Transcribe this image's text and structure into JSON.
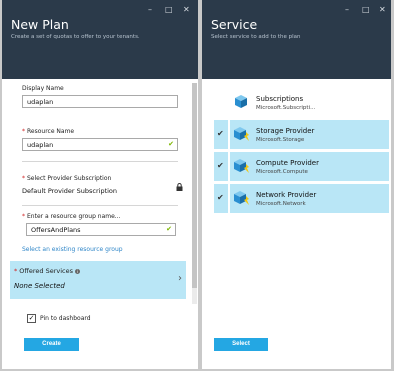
{
  "left_blade": {
    "title": "New Plan",
    "subtitle": "Create a set of quotas to offer to your tenants.",
    "display_name_label": "Display Name",
    "display_name_value": "udaplan",
    "resource_name_label": "Resource Name",
    "resource_name_value": "udaplan",
    "subscription_label": "Select Provider Subscription",
    "subscription_value": "Default Provider Subscription",
    "resource_group_label": "Enter a resource group name...",
    "resource_group_value": "OffersAndPlans",
    "existing_group_link": "Select an existing resource group",
    "offered_services_label": "Offered Services",
    "offered_services_value": "None Selected",
    "pin_label": "Pin to dashboard",
    "pin_checked": true,
    "create_button": "Create",
    "header_buttons": [
      "–",
      "□",
      "✕"
    ],
    "required_mark": "*"
  },
  "right_blade": {
    "title": "Service",
    "subtitle": "Select service to add to the plan",
    "header_buttons": [
      "–",
      "□",
      "✕"
    ],
    "select_button": "Select",
    "services": [
      {
        "name": "Subscriptions",
        "sub": "Microsoft.Subscripti...",
        "selected": false
      },
      {
        "name": "Storage Provider",
        "sub": "Microsoft.Storage",
        "selected": true
      },
      {
        "name": "Compute Provider",
        "sub": "Microsoft.Compute",
        "selected": true
      },
      {
        "name": "Network Provider",
        "sub": "Microsoft.Network",
        "selected": true
      }
    ]
  },
  "colors": {
    "header_bg": "#2b3a4a",
    "accent": "#24a7e3",
    "selection": "#b9e6f6",
    "valid_check": "#7db700"
  },
  "icons": {
    "lock": "lock-icon",
    "info": "info-icon",
    "chevron": "chevron-right-icon",
    "service": "service-cube-icon",
    "check": "checkmark-icon"
  }
}
